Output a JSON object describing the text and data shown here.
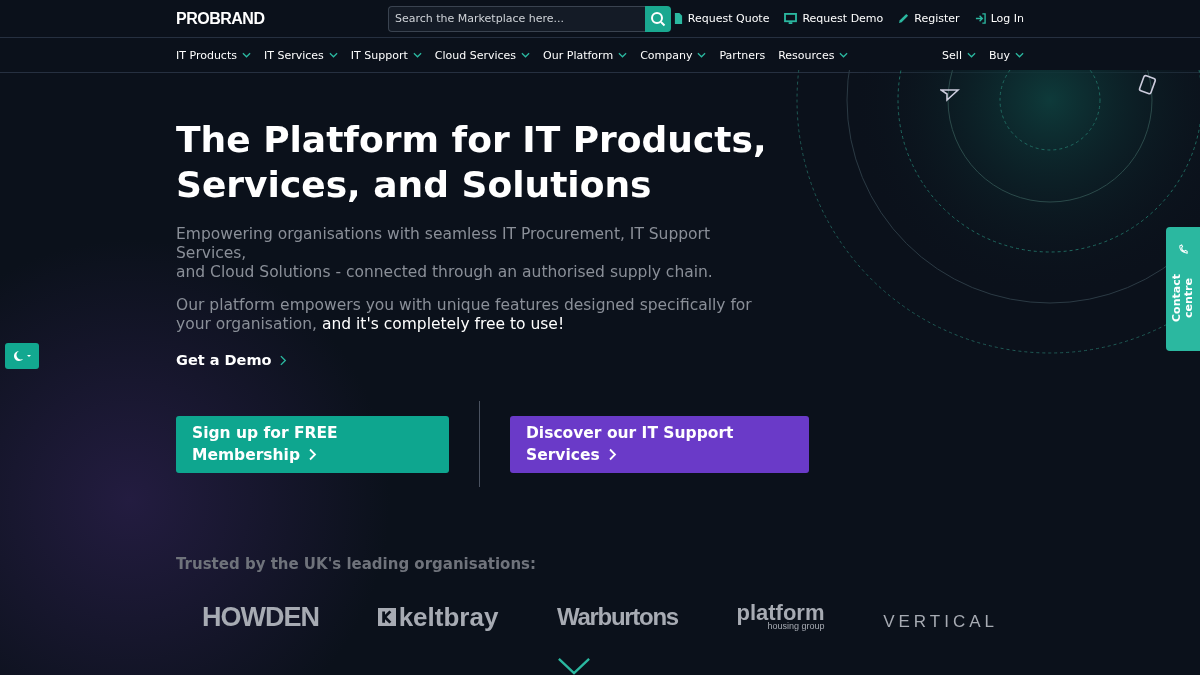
{
  "header": {
    "logo": "PROBRAND",
    "search": {
      "placeholder": "Search the Marketplace here..."
    },
    "actions": [
      {
        "kind": "doc",
        "label": "Request Quote"
      },
      {
        "kind": "monitor",
        "label": "Request Demo"
      },
      {
        "kind": "pen",
        "label": "Register"
      },
      {
        "kind": "login",
        "label": "Log In"
      }
    ]
  },
  "nav": {
    "items": [
      {
        "label": "IT Products",
        "dropdown": true
      },
      {
        "label": "IT Services",
        "dropdown": true
      },
      {
        "label": "IT Support",
        "dropdown": true
      },
      {
        "label": "Cloud Services",
        "dropdown": true
      },
      {
        "label": "Our Platform",
        "dropdown": true
      },
      {
        "label": "Company",
        "dropdown": true
      },
      {
        "label": "Partners",
        "dropdown": false
      },
      {
        "label": "Resources",
        "dropdown": true
      }
    ],
    "right_items": [
      {
        "label": "Sell",
        "dropdown": true
      },
      {
        "label": "Buy",
        "dropdown": true
      }
    ]
  },
  "hero": {
    "title": "The Platform for IT Products, Services, and Solutions",
    "subtitle_lines": [
      "Empowering organisations with seamless IT Procurement, IT Support Services,",
      "and Cloud Solutions - connected through an authorised supply chain."
    ],
    "paragraph": "Our platform empowers you with unique features designed specifically for your organisation, **and it's completely free to use!**",
    "demo_link": "Get a Demo",
    "buttons": [
      {
        "kind": "teal",
        "label": "Sign up for FREE Membership"
      },
      {
        "kind": "purple",
        "label": "Discover our IT Support Services"
      }
    ]
  },
  "trusted": {
    "heading": "Trusted by the UK's leading organisations:",
    "logos": [
      {
        "kind": "howden",
        "text": "HOWDEN"
      },
      {
        "kind": "keltbray",
        "text": "keltbray"
      },
      {
        "kind": "warburtons",
        "text": "Warburtons"
      },
      {
        "kind": "platform",
        "text": "platform",
        "subtext": "housing group"
      },
      {
        "kind": "vertical",
        "text": "VERTICAL"
      }
    ]
  },
  "contact_tab": {
    "label": "Contact centre"
  }
}
